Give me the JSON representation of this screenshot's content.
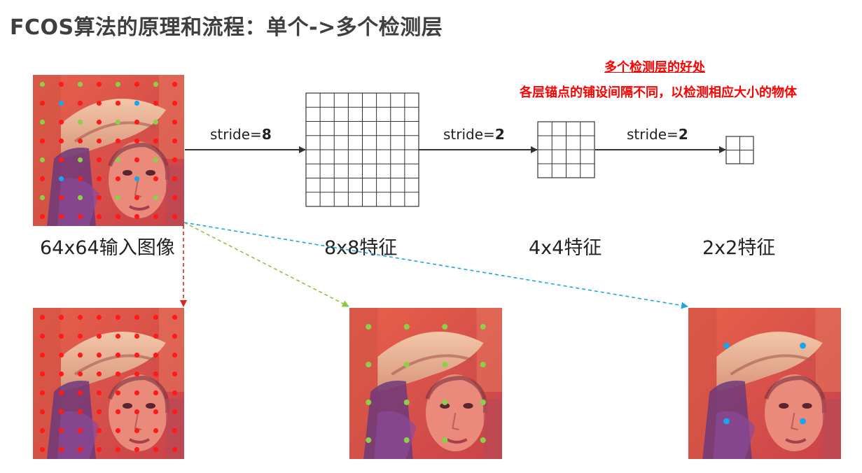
{
  "title": "FCOS算法的原理和流程：单个->多个检测层",
  "note": {
    "heading": "多个检测层的好处",
    "detail": "各层锚点的铺设间隔不同，以检测相应大小的物体"
  },
  "strides": [
    {
      "prefix": "stride=",
      "value": "8"
    },
    {
      "prefix": "stride=",
      "value": "2"
    },
    {
      "prefix": "stride=",
      "value": "2"
    }
  ],
  "captions": {
    "input": "64x64输入图像",
    "feat8": "8x8特征",
    "feat4": "4x4特征",
    "feat2": "2x2特征"
  },
  "grids": {
    "feat8": 8,
    "feat4": 4,
    "feat2": 2
  },
  "colors": {
    "red_anchor": "#ff1a1a",
    "green_anchor": "#8cd04a",
    "blue_anchor": "#1aa3ef",
    "red_arrow": "#e8201a",
    "green_arrow": "#8cc63e",
    "blue_arrow": "#1ba7e3",
    "text_red": "#ff0000"
  },
  "icons": {
    "input_image": "portrait-photo",
    "output_images": [
      "portrait-photo",
      "portrait-photo",
      "portrait-photo"
    ]
  }
}
